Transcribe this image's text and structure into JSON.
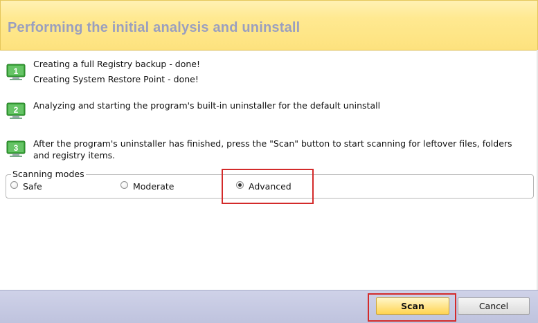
{
  "header": {
    "title": "Performing the initial analysis and uninstall"
  },
  "steps": [
    {
      "number": "1",
      "icon": "monitor-step-1-icon",
      "lines": [
        "Creating a full Registry backup - done!",
        "Creating System Restore Point - done!"
      ]
    },
    {
      "number": "2",
      "icon": "monitor-step-2-icon",
      "lines": [
        "Analyzing and starting the program's built-in uninstaller for the default uninstall"
      ]
    },
    {
      "number": "3",
      "icon": "monitor-step-3-icon",
      "lines": [
        "After the program's uninstaller has finished, press the \"Scan\" button to start scanning for leftover files, folders and registry items."
      ]
    }
  ],
  "scanning_modes": {
    "legend": "Scanning modes",
    "options": [
      {
        "label": "Safe",
        "checked": false
      },
      {
        "label": "Moderate",
        "checked": false
      },
      {
        "label": "Advanced",
        "checked": true
      }
    ]
  },
  "footer": {
    "scan_label": "Scan",
    "cancel_label": "Cancel"
  },
  "colors": {
    "header_title": "#9a9fbf",
    "highlight": "#d32a2a",
    "icon_green": "#3aa53a",
    "footer": "#c6c9e2"
  }
}
